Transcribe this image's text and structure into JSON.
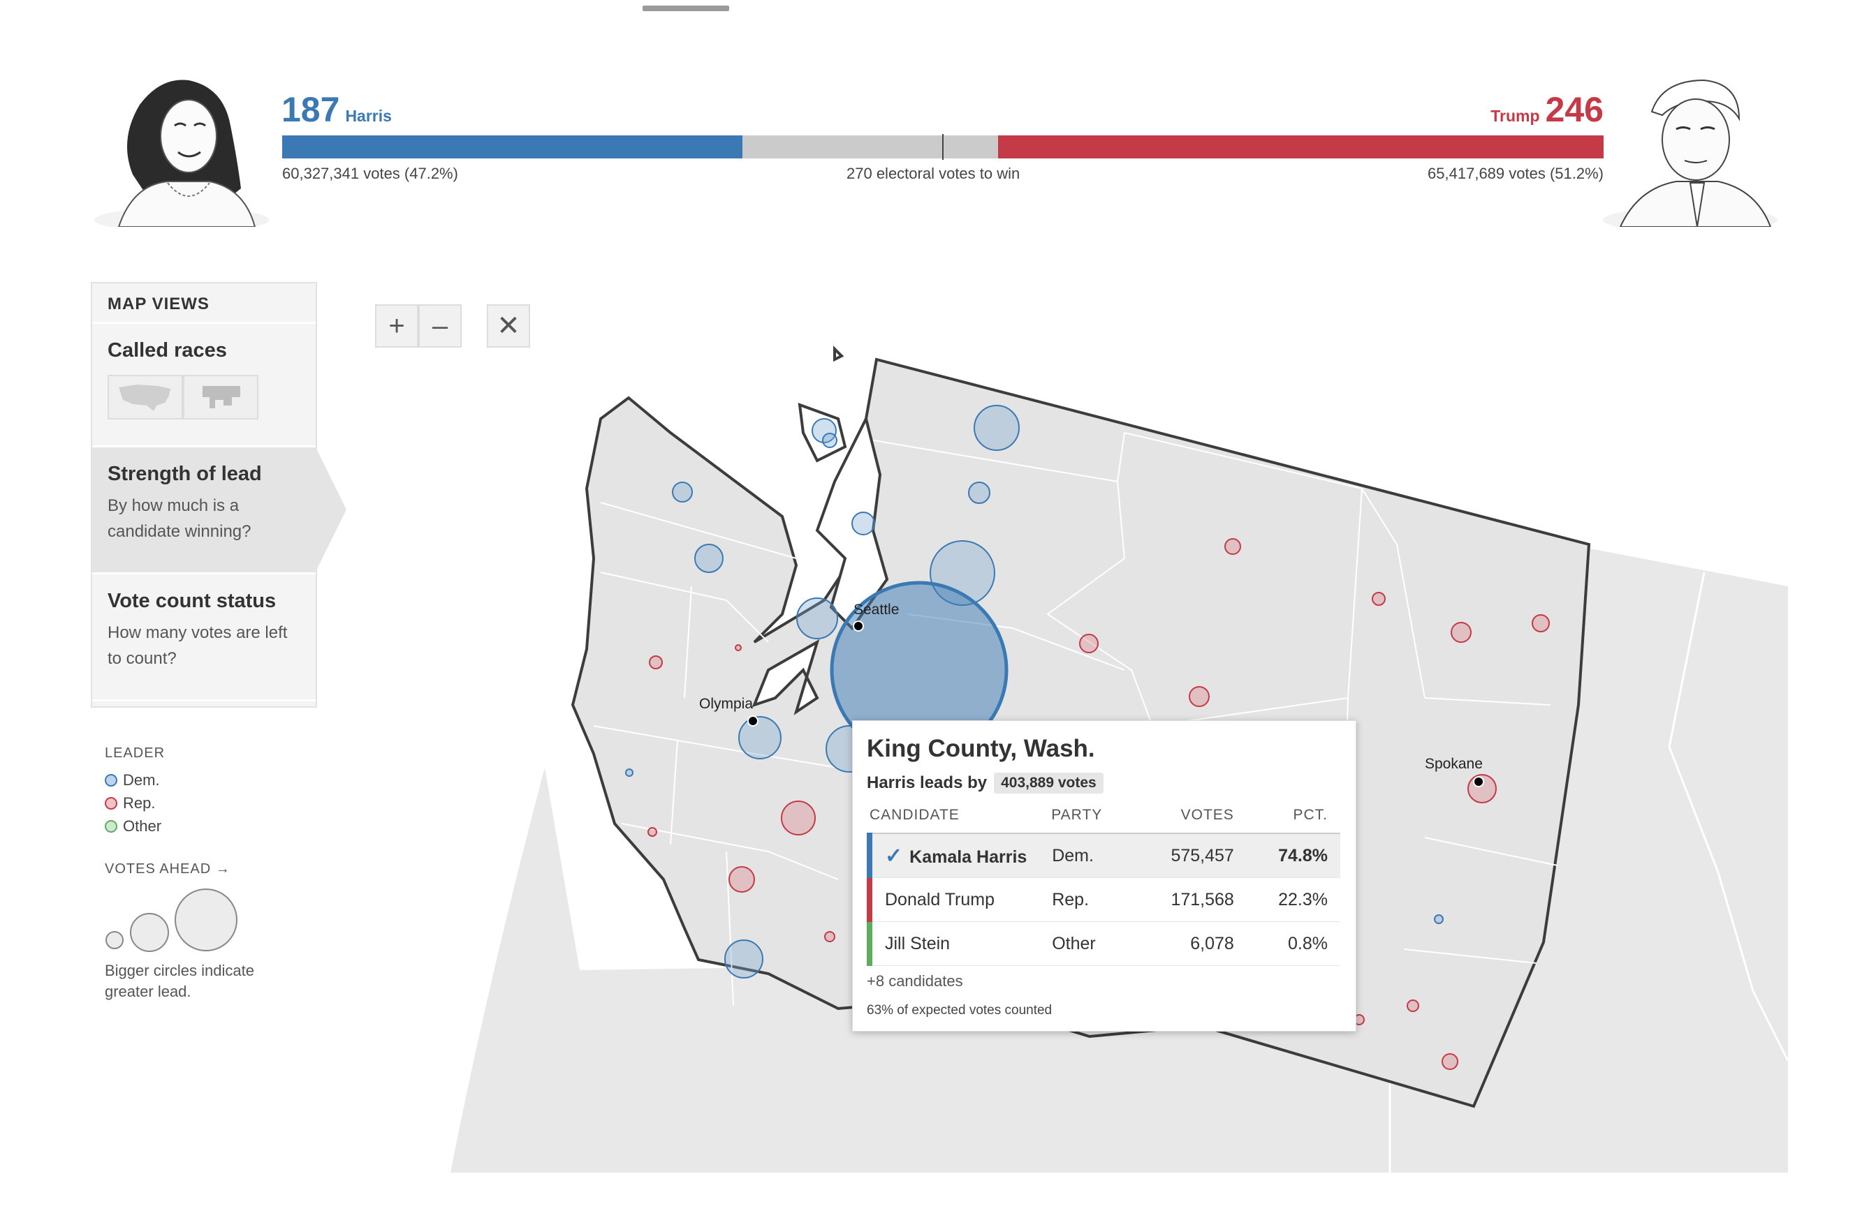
{
  "header": {
    "harris": {
      "ev": "187",
      "name": "Harris",
      "votes": "60,327,341 votes (47.2%)",
      "ev_share": 0.3485,
      "color": "#3a79b3"
    },
    "trump": {
      "ev": "246",
      "name": "Trump",
      "votes": "65,417,689 votes (51.2%)",
      "ev_share": 0.4584,
      "color": "#c43a46"
    },
    "to_win": "270 electoral votes to win"
  },
  "map_views": {
    "heading": "MAP VIEWS",
    "called_races": {
      "title": "Called races",
      "icons": [
        "us-map-icon",
        "cartogram-icon"
      ]
    },
    "strength": {
      "title": "Strength of lead",
      "desc": "By how much is a candidate winning?"
    },
    "vote_status": {
      "title": "Vote count status",
      "desc": "How many votes are left to count?"
    }
  },
  "legend": {
    "heading": "LEADER",
    "items": [
      {
        "label": "Dem.",
        "color": "#3a79b3",
        "fill": "#bcd4ea"
      },
      {
        "label": "Rep.",
        "color": "#c43a46",
        "fill": "#efc4c8"
      },
      {
        "label": "Other",
        "color": "#5cad5c",
        "fill": "#cfe8cf"
      }
    ],
    "votes_ahead": "VOTES AHEAD →",
    "note": "Bigger circles indicate greater lead."
  },
  "zoom": {
    "plus": "+",
    "minus": "–",
    "close": "✕"
  },
  "map": {
    "cities": [
      "Seattle",
      "Olympia",
      "Spokane"
    ]
  },
  "tooltip": {
    "county": "King County, Wash.",
    "lead_text": "Harris leads by",
    "lead_votes": "403,889 votes",
    "columns": [
      "CANDIDATE",
      "PARTY",
      "VOTES",
      "PCT."
    ],
    "rows": [
      {
        "name": "Kamala Harris",
        "party": "Dem.",
        "votes": "575,457",
        "pct": "74.8%",
        "color": "#3a79b3",
        "winner": true
      },
      {
        "name": "Donald Trump",
        "party": "Rep.",
        "votes": "171,568",
        "pct": "22.3%",
        "color": "#c43a46",
        "winner": false
      },
      {
        "name": "Jill Stein",
        "party": "Other",
        "votes": "6,078",
        "pct": "0.8%",
        "color": "#5cad5c",
        "winner": false
      }
    ],
    "more": "+8 candidates",
    "expected": "63% of expected votes counted"
  }
}
